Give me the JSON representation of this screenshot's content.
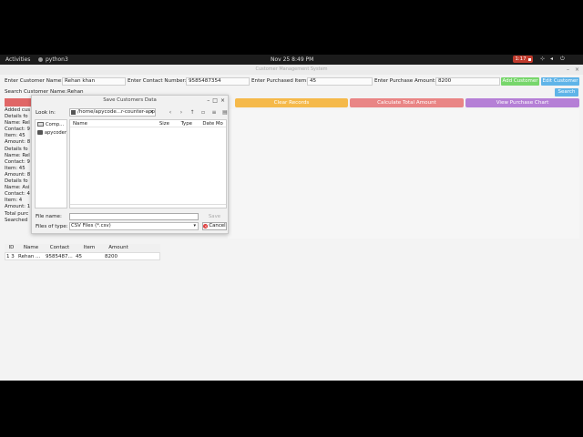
{
  "topbar": {
    "activities": "Activities",
    "app_name": "python3",
    "clock": "Nov 25  8:49 PM",
    "record_time": "1:17"
  },
  "window": {
    "title": "Customer Management System"
  },
  "form": {
    "name_label": "Enter Customer Name:",
    "name_value": "Rehan khan",
    "contact_label": "Enter Contact Number:",
    "contact_value": "9585487354",
    "item_label": "Enter Purchased Item:",
    "item_value": "45",
    "amount_label": "Enter Purchase Amount:",
    "amount_value": "8200",
    "add_button": "Add Customer",
    "edit_button": "Edit Customer",
    "search_label": "Search Customer Name:",
    "search_value": "Rehan",
    "search_button": "Search"
  },
  "actions": {
    "clear": "Clear Records",
    "calculate": "Calculate Total Amount",
    "chart": "View Purchase Chart"
  },
  "colors": {
    "add": "#77d66b",
    "edit": "#5fb4e8",
    "search": "#5fb4e8",
    "clear": "#f5b94a",
    "calculate": "#e98585",
    "chart": "#b57fd6",
    "red_bar": "#e06666"
  },
  "left_panel": {
    "lines": [
      "Added cus",
      "Details fo",
      "Name: Rel",
      "Contact: 9",
      "Item: 45",
      "Amount: 8",
      "Details fo",
      "Name: Rel",
      "Contact: 9",
      "Item: 45",
      "Amount: 8",
      "Details fo",
      "Name: Asi",
      "Contact: 4",
      "Item: 4",
      "Amount: 1",
      "Total purc",
      "Searched"
    ]
  },
  "table": {
    "headers": [
      "ID",
      "Name",
      "Contact",
      "Item",
      "Amount"
    ],
    "rows": [
      [
        "1 3",
        "Rehan ...",
        "9585487...",
        "45",
        "8200"
      ]
    ]
  },
  "dialog": {
    "title": "Save Customers Data",
    "look_in_label": "Look in:",
    "look_in_value": "/home/apycode...r-counter-app",
    "sidebar_items": [
      "Comp...",
      "apycoder"
    ],
    "columns": [
      "Name",
      "Size",
      "Type",
      "Date Mo"
    ],
    "file_name_label": "File name:",
    "file_name_value": "",
    "files_of_type_label": "Files of type:",
    "files_of_type_value": "CSV Files (*.csv)",
    "save_button": "Save",
    "cancel_button": "Cancel"
  }
}
